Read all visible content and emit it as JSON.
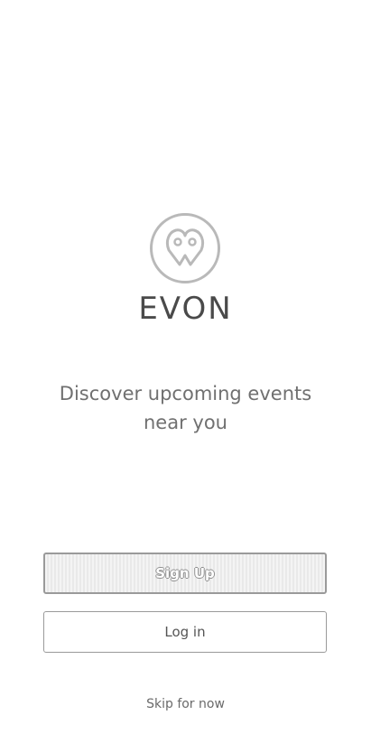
{
  "app": {
    "logo_icon": "evon-logo-icon",
    "brand_name": "EVON"
  },
  "onboarding": {
    "tagline": "Discover upcoming events near you"
  },
  "actions": {
    "signup_label": "Sign Up",
    "login_label": "Log in",
    "skip_label": "Skip for now"
  },
  "colors": {
    "background": "#ffffff",
    "text": "#5c5c5c",
    "border": "#9a9a9a"
  }
}
